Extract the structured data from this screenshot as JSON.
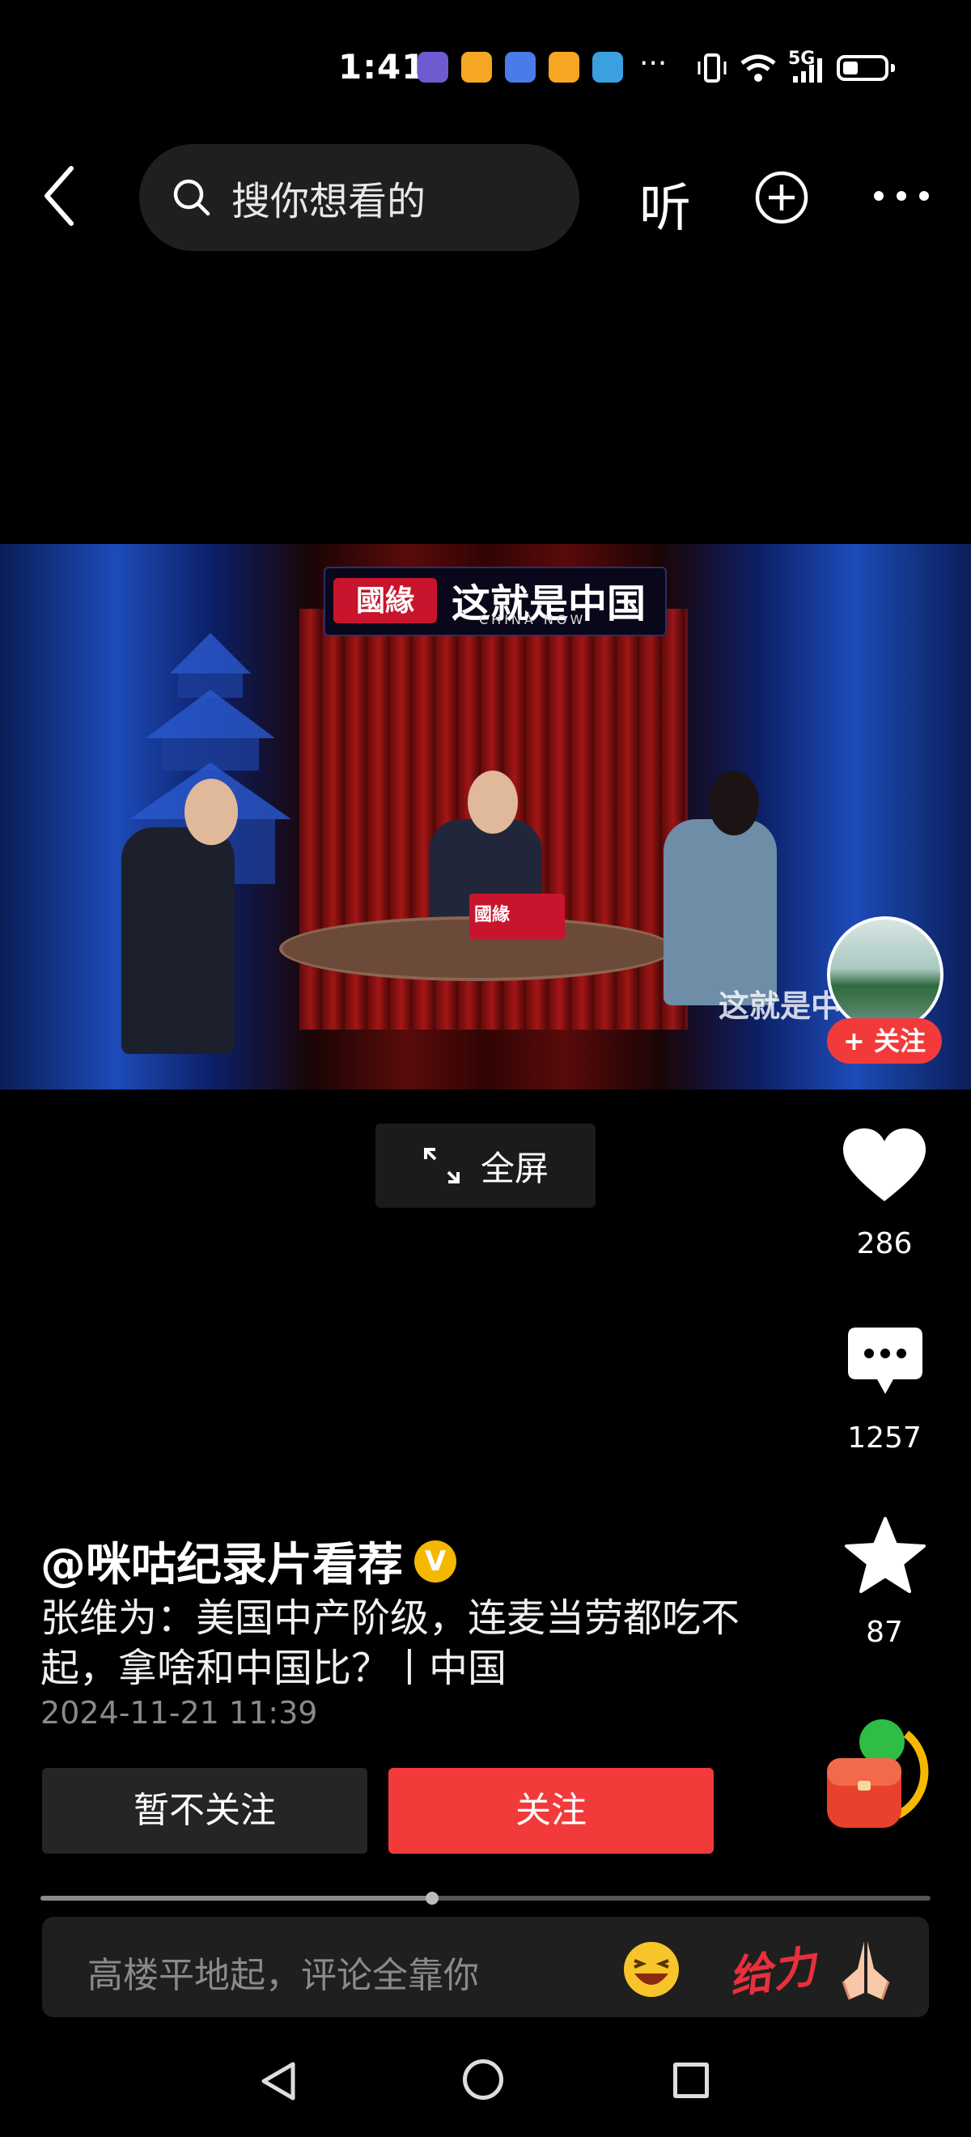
{
  "status_bar": {
    "time": "1:41",
    "network": "5G",
    "overflow": "···"
  },
  "top_bar": {
    "search_placeholder": "搜你想看的",
    "listen_label": "听"
  },
  "video": {
    "channel_logo": "國緣",
    "show_title": "这就是中国",
    "show_subtitle": "CHINA NOW",
    "table_sign": "國緣",
    "watermark": "这就是中",
    "fullscreen_label": "全屏"
  },
  "creator": {
    "follow_label": "+ 关注"
  },
  "actions": {
    "likes": "286",
    "comments": "1257",
    "favorites": "87"
  },
  "post": {
    "author": "@咪咕纪录片看荐",
    "verified_badge": "V",
    "description": "张维为：美国中产阶级，连麦当劳都吃不起，拿啥和中国比？丨中国",
    "date": "2024-11-21 11:39"
  },
  "buttons": {
    "not_follow": "暂不关注",
    "follow": "关注"
  },
  "progress": {
    "played_fraction": 0.44
  },
  "comment_bar": {
    "placeholder": "高楼平地起，评论全靠你",
    "gift_text": "给力"
  },
  "colors": {
    "accent_red": "#f23a3a",
    "badge_gold": "#f5b800",
    "background": "#000000"
  }
}
